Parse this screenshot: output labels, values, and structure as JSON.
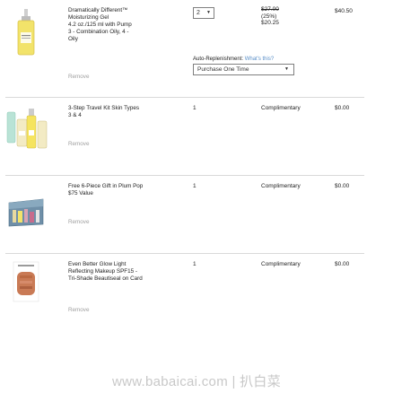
{
  "items": [
    {
      "name_lines": [
        "Dramatically Different™",
        "Moisturizing Gel",
        "4.2 oz./125 ml with Pump",
        "3 - Combination Oily, 4 -",
        "Oily"
      ],
      "remove_label": "Remove",
      "qty_selected": "2",
      "original_price": "$27.00",
      "discount": "(25%)",
      "sale_price": "$20.25",
      "total": "$40.50",
      "auto_replenishment_label": "Auto-Replenishment:",
      "whats_this_link": "What's this?",
      "replenishment_selected": "Purchase One Time"
    },
    {
      "name_lines": [
        "3-Step Travel Kit Skin Types",
        "3 & 4"
      ],
      "remove_label": "Remove",
      "qty": "1",
      "status": "Complimentary",
      "total": "$0.00"
    },
    {
      "name_lines": [
        "Free 6-Piece Gift in Plum Pop",
        "$75 Value"
      ],
      "remove_label": "Remove",
      "qty": "1",
      "status": "Complimentary",
      "total": "$0.00"
    },
    {
      "name_lines": [
        "Even Better Glow Light",
        "Reflecting Makeup SPF15 -",
        "Tri-Shade Beautiseal on Card"
      ],
      "remove_label": "Remove",
      "qty": "1",
      "status": "Complimentary",
      "total": "$0.00"
    }
  ],
  "watermark": "www.babaicai.com | 扒白菜"
}
